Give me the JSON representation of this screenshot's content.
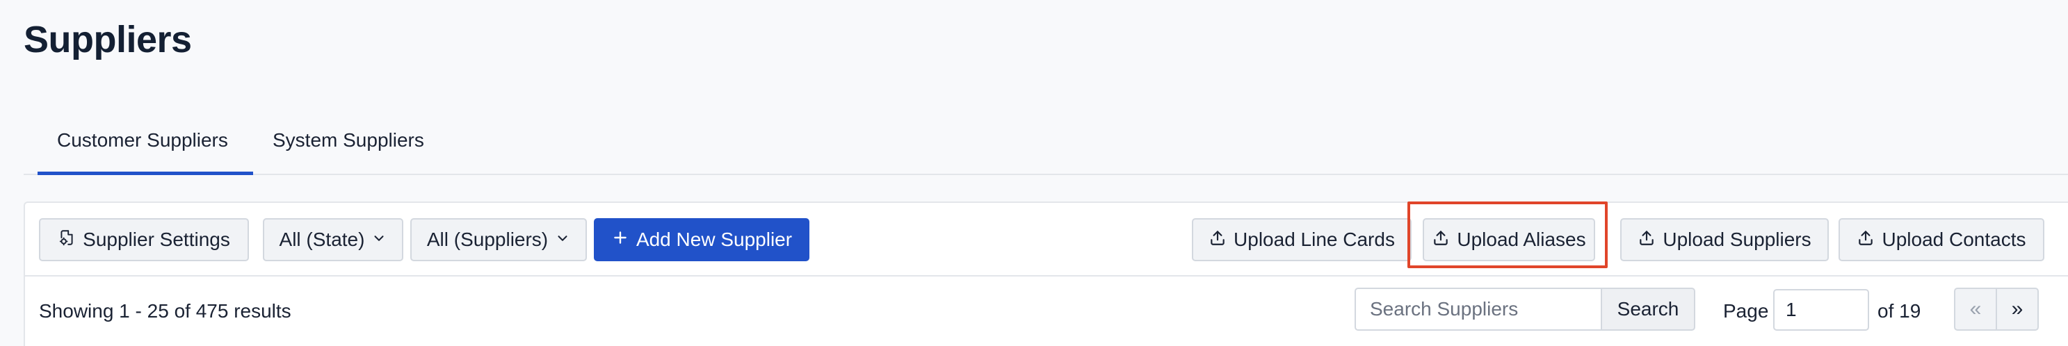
{
  "page": {
    "title": "Suppliers"
  },
  "tabs": [
    {
      "label": "Customer Suppliers",
      "active": true
    },
    {
      "label": "System Suppliers",
      "active": false
    }
  ],
  "toolbar": {
    "supplier_settings": "Supplier Settings",
    "state_filter": "All (State)",
    "supplier_filter": "All (Suppliers)",
    "add_new": "Add New Supplier",
    "upload_line_cards": "Upload Line Cards",
    "upload_aliases": "Upload Aliases",
    "upload_suppliers": "Upload Suppliers",
    "upload_contacts": "Upload Contacts"
  },
  "results": {
    "summary": "Showing 1 - 25 of 475 results"
  },
  "search": {
    "placeholder": "Search Suppliers",
    "button": "Search"
  },
  "pagination": {
    "page_label": "Page",
    "current_page": "1",
    "of_label": "of 19",
    "prev": "«",
    "next": "»"
  },
  "colors": {
    "accent": "#2152c9",
    "highlight": "#e0452a"
  },
  "icons": {
    "settings": "file-gear-icon",
    "chevron": "chevron-down-icon",
    "plus": "plus-icon",
    "upload": "upload-icon"
  }
}
